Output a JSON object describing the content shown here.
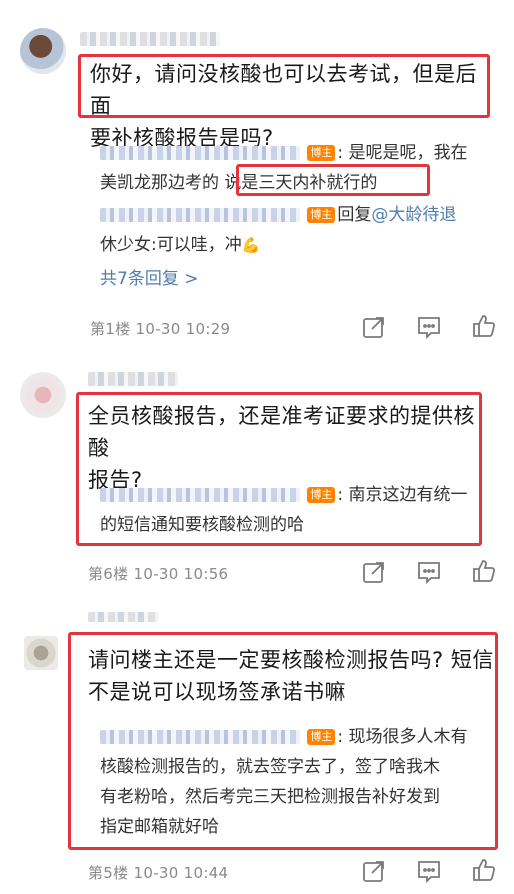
{
  "comments": [
    {
      "text": "你好，请问没核酸也可以去考试，但是后面要补核酸报告是吗?",
      "text_line1": "你好，请问没核酸也可以去考试，但是后面",
      "text_line2": "要补核酸报告是吗?",
      "reply1_badge": "博主",
      "reply1_line1": ": 是呢是呢，我在",
      "reply1_line2_pre": "美凯龙那边考的 ",
      "reply1_line2_highlight": "说是三天内补就行的",
      "reply2_badge": "博主",
      "reply2_prefix": "回复",
      "reply2_mention": "@大龄待退",
      "reply2_line2": "休少女:可以哇，冲",
      "reply2_emoji": "💪",
      "more_replies": "共7条回复 >",
      "meta": "第1楼  10-30 10:29"
    },
    {
      "text_line1": "全员核酸报告，还是准考证要求的提供核酸",
      "text_line2": "报告?",
      "reply1_badge": "博主",
      "reply1_line1": ": 南京这边有统一",
      "reply1_line2": "的短信通知要核酸检测的哈",
      "meta": "第6楼  10-30 10:56"
    },
    {
      "text_line1": "请问楼主还是一定要核酸检测报告吗? 短信",
      "text_line2": "不是说可以现场签承诺书嘛",
      "reply1_badge": "博主",
      "reply1_line1": ": 现场很多人木有",
      "reply1_line2": "核酸检测报告的，就去签字去了，签了啥我木",
      "reply1_line3": "有老粉哈，然后考完三天把检测报告补好发到",
      "reply1_line4": "指定邮箱就好哈",
      "meta": "第5楼  10-30 10:44"
    }
  ],
  "icons": [
    "share-icon",
    "comment-icon",
    "like-icon"
  ],
  "colors": {
    "highlight_box": "#e5343d",
    "link": "#507daf",
    "badge": "#ff8200",
    "meta": "#8a8a8a"
  }
}
